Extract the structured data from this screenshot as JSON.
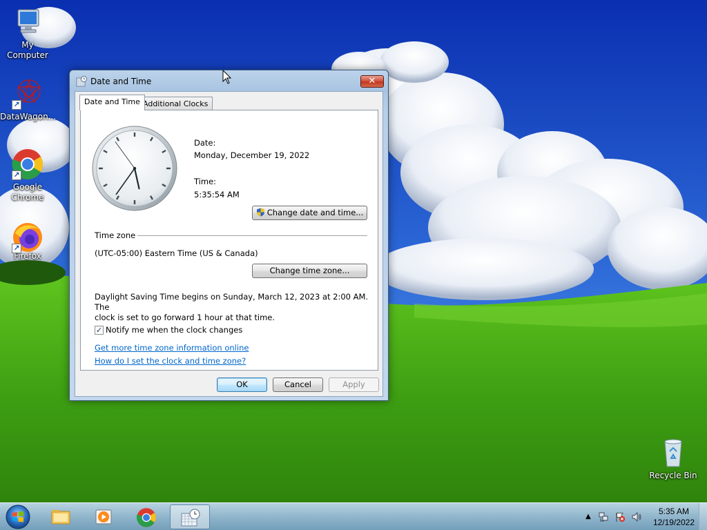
{
  "desktop": {
    "icons": [
      {
        "label": "My Computer",
        "icon": "computer-icon"
      },
      {
        "label": "DataWagon...",
        "icon": "datawagon-icon"
      },
      {
        "label": "Google Chrome",
        "icon": "chrome-icon"
      },
      {
        "label": "Firefox",
        "icon": "firefox-icon"
      },
      {
        "label": "Recycle Bin",
        "icon": "recycle-bin-icon"
      }
    ]
  },
  "window": {
    "title": "Date and Time",
    "tabs": [
      {
        "label": "Date and Time",
        "active": true
      },
      {
        "label": "Additional Clocks",
        "active": false
      }
    ],
    "date_label": "Date:",
    "date_value": "Monday, December 19, 2022",
    "time_label": "Time:",
    "time_value": "5:35:54 AM",
    "change_datetime_button": "Change date and time...",
    "timezone_heading": "Time zone",
    "timezone_value": "(UTC-05:00) Eastern Time (US & Canada)",
    "change_timezone_button": "Change time zone...",
    "dst_line1": "Daylight Saving Time begins on Sunday, March 12, 2023 at 2:00 AM. The",
    "dst_line2": "clock is set to go forward 1 hour at that time.",
    "notify_label": "Notify me when the clock changes",
    "notify_checked": true,
    "link_more_info": "Get more time zone information online",
    "link_how_set": "How do I set the clock and time zone?",
    "ok_button": "OK",
    "cancel_button": "Cancel",
    "apply_button": "Apply",
    "clock_time": {
      "hour": 5,
      "minute": 35,
      "second": 54
    }
  },
  "taskbar": {
    "items": [
      "file-explorer-icon",
      "media-player-icon",
      "chrome-icon",
      "date-time-icon"
    ],
    "active_item": "date-time-icon",
    "clock_time": "5:35 AM",
    "clock_date": "12/19/2022"
  },
  "colors": {
    "link": "#0066cc",
    "close_button": "#c0381f",
    "sky": "#1f55c9",
    "grass": "#3a9a16"
  }
}
